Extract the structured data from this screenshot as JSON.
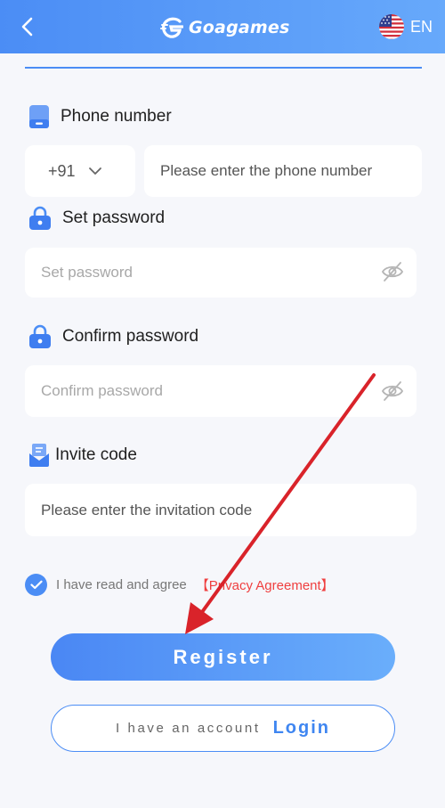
{
  "header": {
    "brand": "Goagames",
    "language": "EN",
    "icons": {
      "back": "chevron-left-icon",
      "logo": "goagames-logo-icon",
      "flag": "us-flag-icon"
    }
  },
  "form": {
    "phone": {
      "label": "Phone number",
      "country_code": "+91",
      "placeholder": "Please enter the phone number",
      "icon": "phone-icon"
    },
    "password": {
      "label": "Set password",
      "placeholder": "Set password",
      "icon": "lock-icon"
    },
    "confirm_password": {
      "label": "Confirm password",
      "placeholder": "Confirm password",
      "icon": "lock-icon"
    },
    "invite": {
      "label": "Invite code",
      "placeholder": "Please enter the invitation code",
      "icon": "invite-icon"
    }
  },
  "agreement": {
    "text": "I have read and agree",
    "link": "【Privacy Agreement】",
    "checked": true
  },
  "actions": {
    "register": "Register",
    "have_account": "I have an account",
    "login": "Login"
  },
  "colors": {
    "accent": "#4b8df5",
    "link_red": "#ef3f3f",
    "annotation_arrow": "#d9232a",
    "background": "#f6f7fb"
  }
}
